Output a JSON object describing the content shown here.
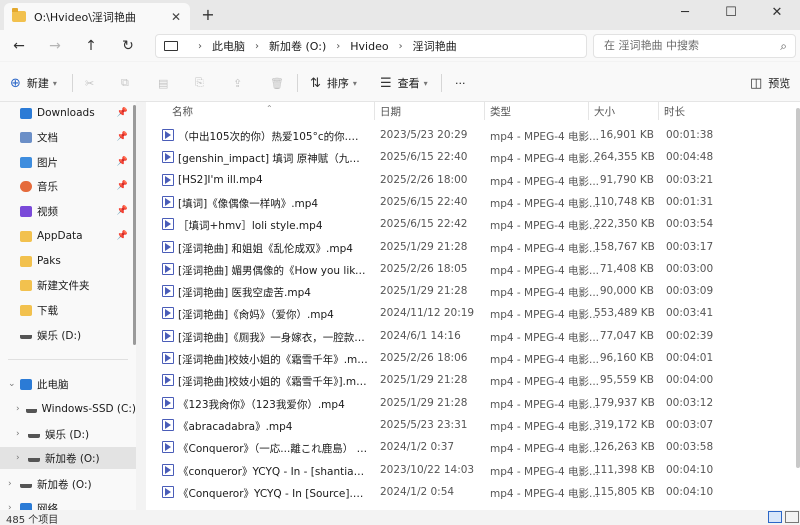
{
  "window": {
    "tab_title": "O:\\Hvideo\\淫词艳曲",
    "new_tab": "+",
    "min_glyph": "─",
    "max_glyph": "☐",
    "close_glyph": "✕"
  },
  "nav": {
    "back": "←",
    "forward": "→",
    "up": "↑",
    "refresh": "↻"
  },
  "breadcrumbs": [
    "此电脑",
    "新加卷 (O:)",
    "Hvideo",
    "淫词艳曲"
  ],
  "breadcrumb_sep": "›",
  "search": {
    "placeholder": "在 淫词艳曲 中搜索"
  },
  "toolbar": {
    "new_label": "新建",
    "sort_label": "排序",
    "view_label": "查看",
    "more_label": "···",
    "preview_label": "预览"
  },
  "sidebar": {
    "quick": [
      {
        "label": "Downloads",
        "icon": "download-icon",
        "pinned": true
      },
      {
        "label": "文档",
        "icon": "document-icon",
        "pinned": true
      },
      {
        "label": "图片",
        "icon": "picture-icon",
        "pinned": true
      },
      {
        "label": "音乐",
        "icon": "music-icon",
        "pinned": true
      },
      {
        "label": "视频",
        "icon": "video-icon",
        "pinned": true
      },
      {
        "label": "AppData",
        "icon": "folder-icon",
        "pinned": true
      },
      {
        "label": "Paks",
        "icon": "folder-icon",
        "pinned": false
      },
      {
        "label": "新建文件夹",
        "icon": "folder-icon",
        "pinned": false
      },
      {
        "label": "下载",
        "icon": "folder-icon",
        "pinned": false
      },
      {
        "label": "娱乐 (D:)",
        "icon": "drive-icon",
        "pinned": false
      }
    ],
    "this_pc": "此电脑",
    "drives": [
      {
        "label": "Windows-SSD (C:)"
      },
      {
        "label": "娱乐 (D:)"
      },
      {
        "label": "新加卷 (O:)",
        "selected": true
      }
    ],
    "extra": [
      {
        "label": "新加卷 (O:)"
      },
      {
        "label": "网络"
      }
    ]
  },
  "columns": {
    "name": "名称",
    "date": "日期",
    "type": "类型",
    "size": "大小",
    "duration": "时长"
  },
  "files": [
    {
      "name": "（中出105次的你）热爱105°c的你.mp4",
      "date": "2023/5/23 20:29",
      "type": "mp4 - MPEG-4 电影...",
      "size": "16,901 KB",
      "duration": "00:01:38"
    },
    {
      "name": "[genshin_impact] 填词 原神赋（九九八十一...",
      "date": "2025/6/15 22:40",
      "type": "mp4 - MPEG-4 电影...",
      "size": "264,355 KB",
      "duration": "00:04:48"
    },
    {
      "name": "[HS2]I'm ill.mp4",
      "date": "2025/2/26 18:00",
      "type": "mp4 - MPEG-4 电影...",
      "size": "91,790 KB",
      "duration": "00:03:21"
    },
    {
      "name": "[填词]《像偶像一样呐》.mp4",
      "date": "2025/6/15 22:40",
      "type": "mp4 - MPEG-4 电影...",
      "size": "110,748 KB",
      "duration": "00:01:31"
    },
    {
      "name": "［填词+hmv］loli style.mp4",
      "date": "2025/6/15 22:42",
      "type": "mp4 - MPEG-4 电影...",
      "size": "222,350 KB",
      "duration": "00:03:54"
    },
    {
      "name": "[淫词艳曲] 和姐姐《乱伦成双》.mp4",
      "date": "2025/1/29 21:28",
      "type": "mp4 - MPEG-4 电影...",
      "size": "158,767 KB",
      "duration": "00:03:17"
    },
    {
      "name": "[淫词艳曲] 媚男偶像的《How you like that...",
      "date": "2025/2/26 18:05",
      "type": "mp4 - MPEG-4 电影...",
      "size": "71,408 KB",
      "duration": "00:03:00"
    },
    {
      "name": "[淫词艳曲] 医我空虚苦.mp4",
      "date": "2025/1/29 21:28",
      "type": "mp4 - MPEG-4 电影...",
      "size": "90,000 KB",
      "duration": "00:03:09"
    },
    {
      "name": "[淫词艳曲]《肏妈》（爱你）.mp4",
      "date": "2024/11/12 20:19",
      "type": "mp4 - MPEG-4 电影...",
      "size": "553,489 KB",
      "duration": "00:03:41"
    },
    {
      "name": "[淫词艳曲]《厕我》一身嫁衣，一腔款腥[1]....",
      "date": "2024/6/1 14:16",
      "type": "mp4 - MPEG-4 电影...",
      "size": "77,047 KB",
      "duration": "00:02:39"
    },
    {
      "name": "[淫词艳曲]校妓小姐的《霜雪千年》.mp4",
      "date": "2025/2/26 18:06",
      "type": "mp4 - MPEG-4 电影...",
      "size": "96,160 KB",
      "duration": "00:04:01"
    },
    {
      "name": "[淫词艳曲]校妓小姐的《霜雪千年》].mp4",
      "date": "2025/1/29 21:28",
      "type": "mp4 - MPEG-4 电影...",
      "size": "95,559 KB",
      "duration": "00:04:00"
    },
    {
      "name": "《123我肏你》（123我爱你）.mp4",
      "date": "2025/1/29 21:28",
      "type": "mp4 - MPEG-4 电影...",
      "size": "179,937 KB",
      "duration": "00:03:12"
    },
    {
      "name": "《abracadabra》.mp4",
      "date": "2025/5/23 23:31",
      "type": "mp4 - MPEG-4 电影...",
      "size": "319,172 KB",
      "duration": "00:03:07"
    },
    {
      "name": "《Conqueror》（一応...離これ鹿島） YCYQ...",
      "date": "2024/1/2 0:37",
      "type": "mp4 - MPEG-4 电影...",
      "size": "126,263 KB",
      "duration": "00:03:58"
    },
    {
      "name": "《conqueror》YCYQ - In - [shantianxiaozh...",
      "date": "2023/10/22 14:03",
      "type": "mp4 - MPEG-4 电影...",
      "size": "111,398 KB",
      "duration": "00:04:10"
    },
    {
      "name": "《Conqueror》YCYQ - In [Source].mp4",
      "date": "2024/1/2 0:54",
      "type": "mp4 - MPEG-4 电影...",
      "size": "115,805 KB",
      "duration": "00:04:10"
    }
  ],
  "status": {
    "count": "485 个项目"
  }
}
